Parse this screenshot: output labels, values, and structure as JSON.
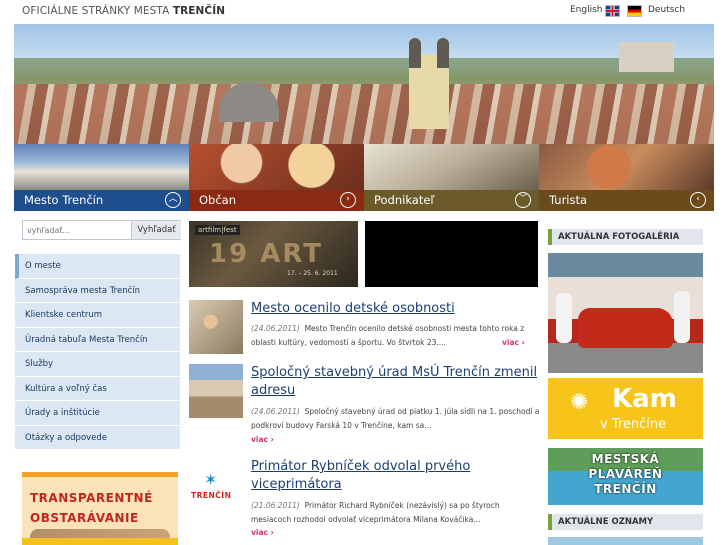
{
  "header": {
    "title_prefix": "OFICIÁLNE STRÁNKY MESTA ",
    "title_city": "TRENČÍN",
    "lang_en": "English",
    "lang_de": "Deutsch"
  },
  "categories": [
    {
      "label": "Mesto Trenčín",
      "icon": "chevron-up-icon",
      "glyph": "︿",
      "color": "#1f4e8c"
    },
    {
      "label": "Občan",
      "icon": "chevron-right-icon",
      "glyph": "›",
      "color": "#8a2a12"
    },
    {
      "label": "Podnikateľ",
      "icon": "chevron-down-icon",
      "glyph": "﹀",
      "color": "#6b5b2a"
    },
    {
      "label": "Turista",
      "icon": "chevron-left-icon",
      "glyph": "‹",
      "color": "#6b4a1c"
    }
  ],
  "search": {
    "placeholder": "vyhľadať...",
    "button": "Vyhľadať"
  },
  "menu": [
    "O meste",
    "Samospráva mesta Trenčín",
    "Klientske centrum",
    "Úradná tabuľa Mesta Trenčín",
    "Služby",
    "Kultúra a voľný čas",
    "Úrady a inštitúcie",
    "Otázky a odpovede"
  ],
  "banners": {
    "transparent_line1": "TRANSPARENTNÉ",
    "transparent_line2": "OBSTARÁVANIE",
    "artfilm_logo": "artfilm|fest",
    "artfilm_big": "19 ART",
    "artfilm_dates": "17. – 25. 6. 2011"
  },
  "news": [
    {
      "title": "Mesto ocenilo detské osobnosti",
      "date": "(24.06.2011)",
      "text": "Mesto Trenčín ocenilo detské osobnosti mesta tohto roka z oblasti kultúry, vedomostí a športu. Vo štvrtok 23....",
      "more": "viac"
    },
    {
      "title": "Spoločný stavebný úrad MsÚ Trenčín zmenil adresu",
      "date": "(24.06.2011)",
      "text": "Spoločný stavebný úrad od piatku 1. júla sídli na 1. poschodí a podkroví budovy Farská 10 v Trenčíne, kam sa...",
      "more": "viac"
    },
    {
      "title": "Primátor Rybníček odvolal prvého viceprimátora",
      "date": "(21.06.2011)",
      "text": "Primátor Richard Rybníček (nezávislý) sa po štyroch mesiacoch rozhodol odvolať viceprimátora Milana Kováčika...",
      "more": "viac",
      "logo_text": "TRENČÍN"
    }
  ],
  "right": {
    "gallery_heading": "AKTUÁLNA FOTOGALÉRIA",
    "kam_line1": "Kam",
    "kam_line2": "v Trenčíne",
    "pool_line1": "MESTSKÁ",
    "pool_line2": "PLAVÁREŇ",
    "pool_line3": "TRENČÍN",
    "notices_heading": "AKTUÁLNE OZNAMY"
  }
}
